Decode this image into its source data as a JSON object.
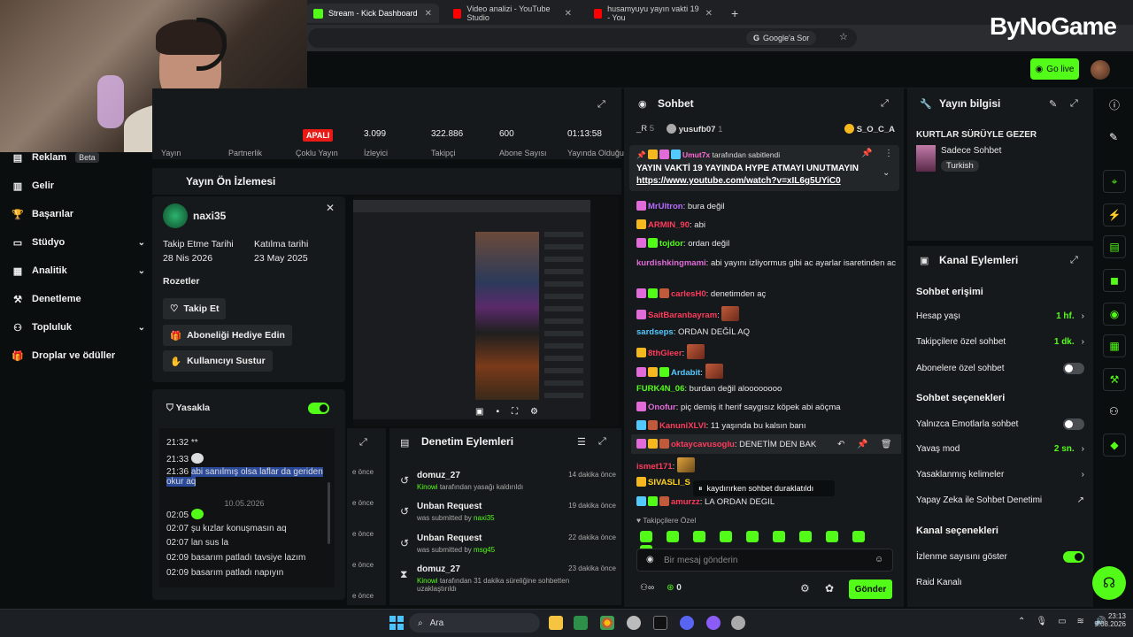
{
  "browser": {
    "tabs": [
      {
        "label": "Stream - Kick Dashboard",
        "color": "#53fc18"
      },
      {
        "label": "Video analizi - YouTube Studio",
        "color": "#ff0000"
      },
      {
        "label": "husamyuyu yayın vakti 19 - You",
        "color": "#ff0000"
      }
    ],
    "search_chip": "Google'a Sor",
    "brand": "ByNoGame"
  },
  "kick": {
    "go_live": "Go live"
  },
  "sidebar": {
    "items": [
      {
        "label": "Reklam",
        "badge": "Beta",
        "icon": "ad-icon"
      },
      {
        "label": "Gelir",
        "icon": "revenue-icon"
      },
      {
        "label": "Başarılar",
        "icon": "trophy-icon"
      },
      {
        "label": "Stüdyo",
        "icon": "studio-icon"
      },
      {
        "label": "Analitik",
        "icon": "analytics-icon"
      },
      {
        "label": "Denetleme",
        "icon": "moderation-icon"
      },
      {
        "label": "Topluluk",
        "icon": "community-icon"
      },
      {
        "label": "Droplar ve ödüller",
        "icon": "gift-icon"
      }
    ]
  },
  "stats": {
    "closed_badge": "APALI",
    "items": [
      {
        "value": "",
        "label": "Yayın"
      },
      {
        "value": "",
        "label": "Partnerlik"
      },
      {
        "value": "",
        "label": "Çoklu Yayın"
      },
      {
        "value": "3.099",
        "label": "İzleyici"
      },
      {
        "value": "322.886",
        "label": "Takipçi"
      },
      {
        "value": "600",
        "label": "Abone Sayısı"
      },
      {
        "value": "01:13:58",
        "label": "Yayında Olduğu"
      }
    ]
  },
  "preview": {
    "title": "Yayın Ön İzlemesi"
  },
  "usercard": {
    "username": "naxi35",
    "follow_date_label": "Takip Etme Tarihi",
    "follow_date": "28 Nis 2026",
    "join_date_label": "Katılma tarihi",
    "join_date": "23 May 2025",
    "badges_label": "Rozetler",
    "buttons": [
      "Takip Et",
      "Aboneliği Hediye Edin",
      "Kullanıcıyı Sustur"
    ],
    "ban_label": "Yasakla",
    "log": [
      {
        "time": "21:32",
        "text": "**"
      },
      {
        "time": "21:33",
        "text": ""
      },
      {
        "time": "21:36",
        "text": "abi sanılmış olsa laflar da geriden okur aq"
      },
      {
        "date": "10.05.2026"
      },
      {
        "time": "02:05",
        "text": ""
      },
      {
        "time": "02:07",
        "text": "şu kızlar konuşmasın aq"
      },
      {
        "time": "02:07",
        "text": "lan sus la"
      },
      {
        "time": "02:09",
        "text": "basarım patladı tavsiye lazım"
      },
      {
        "time": "02:09",
        "text": "basarım patladı napıyın"
      }
    ]
  },
  "mod_actions": {
    "title": "Denetim Eylemleri",
    "side_times": [
      "e önce",
      "e önce",
      "e önce",
      "e önce",
      "e önce"
    ],
    "items": [
      {
        "title": "domuz_27",
        "actor": "Kinowi",
        "detail": "tarafından yasağı kaldırıldı",
        "time": "14 dakika önce",
        "icon": "undo-icon"
      },
      {
        "title": "Unban Request",
        "actor": "naxi35",
        "detail": "was submitted by",
        "time": "19 dakika önce",
        "icon": "undo-icon"
      },
      {
        "title": "Unban Request",
        "actor": "msg45",
        "detail": "was submitted by",
        "time": "22 dakika önce",
        "icon": "undo-icon"
      },
      {
        "title": "domuz_27",
        "actor": "Kinowi",
        "detail": "tarafından 31 dakika süreliğine sohbetten uzaklaştırıldı",
        "time": "23 dakika önce",
        "icon": "hourglass-icon"
      }
    ]
  },
  "chat": {
    "title": "Sohbet",
    "top_chatters": [
      {
        "name": "_R",
        "count": "5"
      },
      {
        "name": "yusufb07",
        "count": "1"
      },
      {
        "name": "S_O_C_A",
        "count": ""
      }
    ],
    "pinned": {
      "user": "Umut7x",
      "pinned_by": "tarafından sabitlendi",
      "text": "YAYIN VAKTİ 19 YAYINDA HYPE ATMAYI UNUTMAYIN",
      "link": "https://www.youtube.com/watch?v=xIL6g5UYiC0"
    },
    "messages": [
      {
        "user": "MrUltron",
        "color": "#b86bff",
        "text": "bura değil"
      },
      {
        "user": "ARMIN_90",
        "color": "#ff3b5c",
        "text": "abi"
      },
      {
        "user": "tojdor",
        "color": "#53fc18",
        "text": "ordan değil"
      },
      {
        "user": "kurdishkingmami",
        "color": "#e06bd9",
        "text": "abi yayını izliyormus gibi ac ayarlar isaretinden ac"
      },
      {
        "user": "carlesH0",
        "color": "#ff3b5c",
        "text": "denetimden aç"
      },
      {
        "user": "SaitBaranbayram",
        "color": "#ff3b5c",
        "text": ""
      },
      {
        "user": "sardseps",
        "color": "#53c9ff",
        "text": "ORDAN DEĞİL AQ"
      },
      {
        "user": "8thGleer",
        "color": "#ff3b5c",
        "text": ""
      },
      {
        "user": "Ardabit",
        "color": "#53c9ff",
        "text": ""
      },
      {
        "user": "FURK4N_06",
        "color": "#53fc18",
        "text": "burdan değil aloooooooo"
      },
      {
        "user": "Onofur",
        "color": "#e06bd9",
        "text": "piç demiş it herif saygısız köpek abi aöçma"
      },
      {
        "user": "KanuniXLVI",
        "color": "#ff3b5c",
        "text": "11 yaşında bu kalsın banı"
      },
      {
        "user": "oktaycavusoglu",
        "color": "#ff3b5c",
        "text": "DENETİM DEN BAK"
      },
      {
        "user": "ismet171",
        "color": "#ff3b5c",
        "text": ""
      },
      {
        "user": "SIVASLI_S",
        "color": "#ffd21f",
        "text": ""
      },
      {
        "user": "amurzz",
        "color": "#ff3b5c",
        "text": "LA ORDAN DEGIL"
      }
    ],
    "paused_notice": "kaydırırken sohbet duraklatıldı",
    "followers_only": "Takipçilere Özel",
    "input_placeholder": "Bir mesaj gönderin",
    "points": "0",
    "send_label": "Gönder"
  },
  "stream_info": {
    "title": "Yayın bilgisi",
    "stream_title": "KURTLAR SÜRÜYLE GEZER",
    "category": "Sadece Sohbet",
    "language": "Turkish"
  },
  "channel_actions": {
    "title": "Kanal Eylemleri",
    "chat_access": "Sohbet erişimi",
    "account_age_label": "Hesap yaşı",
    "account_age": "1 hf.",
    "followers_only_label": "Takipçilere özel sohbet",
    "followers_only_value": "1 dk.",
    "subs_only_label": "Abonelere özel sohbet",
    "chat_options": "Sohbet seçenekleri",
    "emotes_only_label": "Yalnızca Emotlarla sohbet",
    "slow_mode_label": "Yavaş mod",
    "slow_mode_value": "2 sn.",
    "banned_words_label": "Yasaklanmış kelimeler",
    "ai_mod_label": "Yapay Zeka ile Sohbet Denetimi",
    "channel_options": "Kanal seçenekleri",
    "show_viewers_label": "İzlenme sayısını göster",
    "raid_label": "Raid Kanalı"
  },
  "taskbar": {
    "search": "Ara",
    "time": "23:13",
    "date": "9.08.2026"
  }
}
